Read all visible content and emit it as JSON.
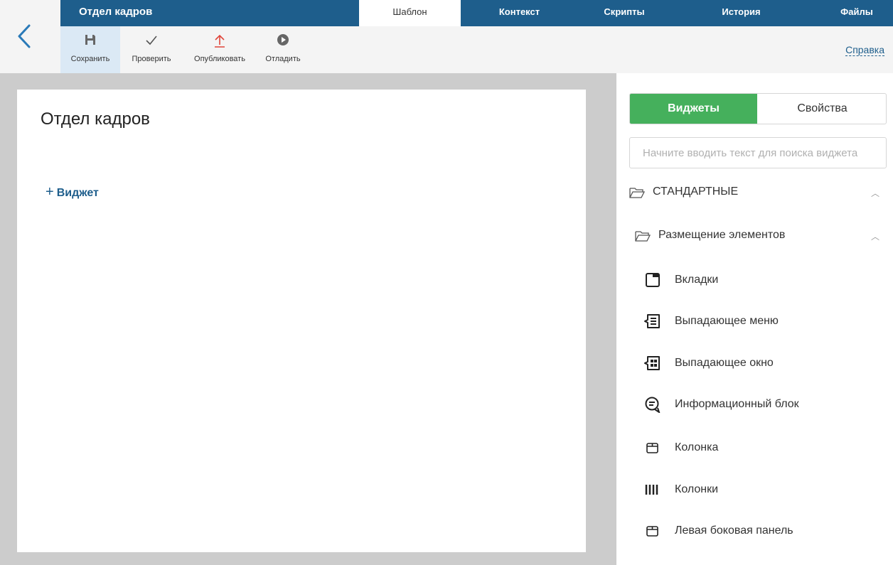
{
  "header": {
    "title": "Отдел кадров",
    "tabs": [
      "Шаблон",
      "Контекст",
      "Скрипты",
      "История",
      "Файлы"
    ],
    "active_tab": "Шаблон"
  },
  "toolbar": {
    "save_label": "Сохранить",
    "check_label": "Проверить",
    "publish_label": "Опубликовать",
    "debug_label": "Отладить",
    "help_label": "Справка"
  },
  "canvas": {
    "page_title": "Отдел кадров",
    "add_widget_label": "Виджет"
  },
  "panel": {
    "tab_widgets": "Виджеты",
    "tab_properties": "Свойства",
    "search_placeholder": "Начните вводить текст для поиска виджета",
    "group_standard": "СТАНДАРТНЫЕ",
    "subgroup_layout": "Размещение элементов",
    "widgets": [
      {
        "label": "Вкладки",
        "icon": "tabs-icon"
      },
      {
        "label": "Выпадающее меню",
        "icon": "dropdown-menu-icon"
      },
      {
        "label": "Выпадающее окно",
        "icon": "dropdown-window-icon"
      },
      {
        "label": "Информационный блок",
        "icon": "info-block-icon"
      },
      {
        "label": "Колонка",
        "icon": "column-icon"
      },
      {
        "label": "Колонки",
        "icon": "columns-icon"
      },
      {
        "label": "Левая боковая панель",
        "icon": "left-sidebar-icon"
      }
    ]
  },
  "colors": {
    "header_bg": "#1e5e8c",
    "accent_green": "#45b05c",
    "toolbar_bg": "#f4f4f4",
    "canvas_bg": "#cccccc",
    "link_blue": "#1e5e8c",
    "publish_red": "#e0453a"
  }
}
